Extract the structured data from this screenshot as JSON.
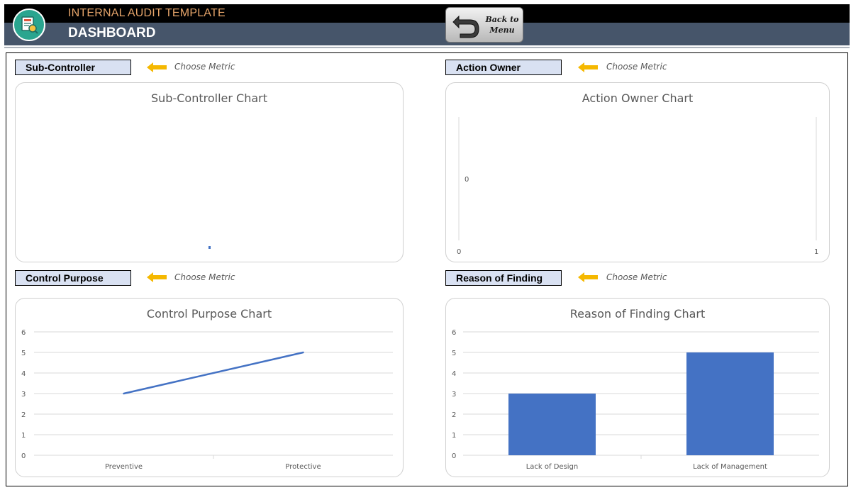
{
  "header": {
    "title": "INTERNAL AUDIT TEMPLATE",
    "subtitle": "DASHBOARD",
    "back_button": "Back to Menu",
    "back_line1": "Back to",
    "back_line2": "Menu"
  },
  "panels": {
    "sub_controller": {
      "label": "Sub-Controller",
      "choose": "Choose Metric",
      "chart_title": "Sub-Controller Chart"
    },
    "action_owner": {
      "label": "Action Owner",
      "choose": "Choose Metric",
      "chart_title": "Action Owner Chart"
    },
    "control_purpose": {
      "label": "Control Purpose",
      "choose": "Choose Metric",
      "chart_title": "Control Purpose Chart"
    },
    "reason_of_finding": {
      "label": "Reason of Finding",
      "choose": "Choose Metric",
      "chart_title": "Reason of Finding Chart"
    }
  },
  "colors": {
    "accent_arrow": "#f5b800",
    "series": "#4472c4",
    "header_bg": "#46556a",
    "label_bg": "#d9e1f2"
  },
  "icons": {
    "app": "report-magnifier-icon",
    "back": "u-turn-arrow-icon",
    "arrow": "left-arrow-icon"
  },
  "chart_data": [
    {
      "type": "bar",
      "title": "Sub-Controller Chart",
      "categories": [],
      "values": [],
      "xlabel": "",
      "ylabel": ""
    },
    {
      "type": "scatter",
      "title": "Action Owner Chart",
      "x_ticks": [
        "0",
        "1"
      ],
      "y_ticks": [
        "0"
      ],
      "xlim": [
        0,
        1
      ],
      "xlabel": "",
      "ylabel": ""
    },
    {
      "type": "line",
      "title": "Control Purpose Chart",
      "categories": [
        "Preventive",
        "Protective"
      ],
      "values": [
        3,
        5
      ],
      "ylim": [
        0,
        6
      ],
      "y_ticks": [
        "0",
        "1",
        "2",
        "3",
        "4",
        "5",
        "6"
      ],
      "grid": true,
      "xlabel": "",
      "ylabel": ""
    },
    {
      "type": "bar",
      "title": "Reason of Finding Chart",
      "categories": [
        "Lack of Design",
        "Lack of Management"
      ],
      "values": [
        3,
        5
      ],
      "ylim": [
        0,
        6
      ],
      "y_ticks": [
        "0",
        "1",
        "2",
        "3",
        "4",
        "5",
        "6"
      ],
      "grid": true,
      "xlabel": "",
      "ylabel": ""
    }
  ]
}
